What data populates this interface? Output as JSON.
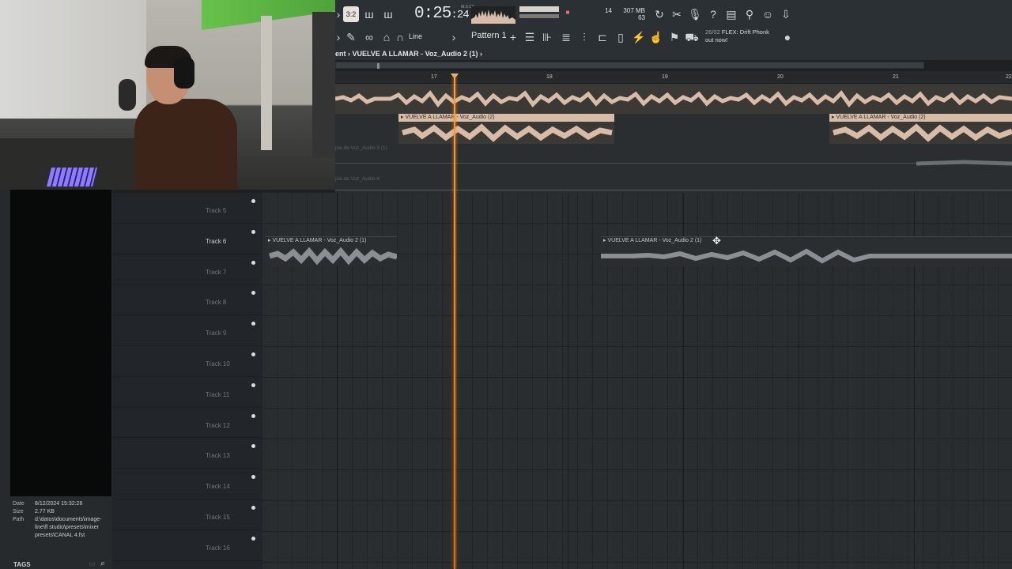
{
  "toolbar": {
    "time_main": "0:25",
    "time_sub": ":24",
    "time_label": "M:S:CS",
    "memory": "307 MB",
    "cpu": "63",
    "polyphony": "14",
    "pattern_label": "Pattern 1",
    "snap_label": "Line",
    "news_id": "26/02",
    "news_text": "FLEX: Drift Phonk",
    "news_text2": "out now!",
    "icons": [
      "record-icon",
      "song-mode-icon",
      "tempo-icon",
      "undo-icon",
      "cut-icon",
      "mic-icon",
      "help-icon",
      "save-icon",
      "render-icon",
      "chat-icon",
      "download-icon"
    ]
  },
  "breadcrumb": {
    "prefix": "ent",
    "clip": "VUELVE A LLAMAR - Voz_Audio 2 (1)",
    "arrow": "›"
  },
  "ruler": {
    "marks": [
      "17",
      "18",
      "19",
      "20",
      "21",
      "22"
    ]
  },
  "upper": {
    "clip_label": "VUELVE A LLAMAR - Voz_Audio (2)",
    "ghost1": "pia de Voz_Audio 3 (1)",
    "ghost2": "pia de Voz_Audio 4"
  },
  "tracks": [
    "Track 5",
    "Track 6",
    "Track 7",
    "Track 8",
    "Track 9",
    "Track 10",
    "Track 11",
    "Track 12",
    "Track 13",
    "Track 14",
    "Track 15",
    "Track 16"
  ],
  "track6_clip_label": "VUELVE A LLAMAR - Voz_Audio 2 (1)",
  "browser": {
    "date_key": "Date",
    "date_val": "8/12/2024 15:32:26",
    "size_key": "Size",
    "size_val": "2.77 KB",
    "path_key": "Path",
    "path_val": "d:\\datos\\documents\\image-line\\fl studio\\presets\\mixer presets\\CANAL 4.fst",
    "tags_label": "TAGS"
  },
  "colors": {
    "playhead": "#ff9c38",
    "clip_light": "#d9bca8",
    "background": "#1e2123"
  }
}
